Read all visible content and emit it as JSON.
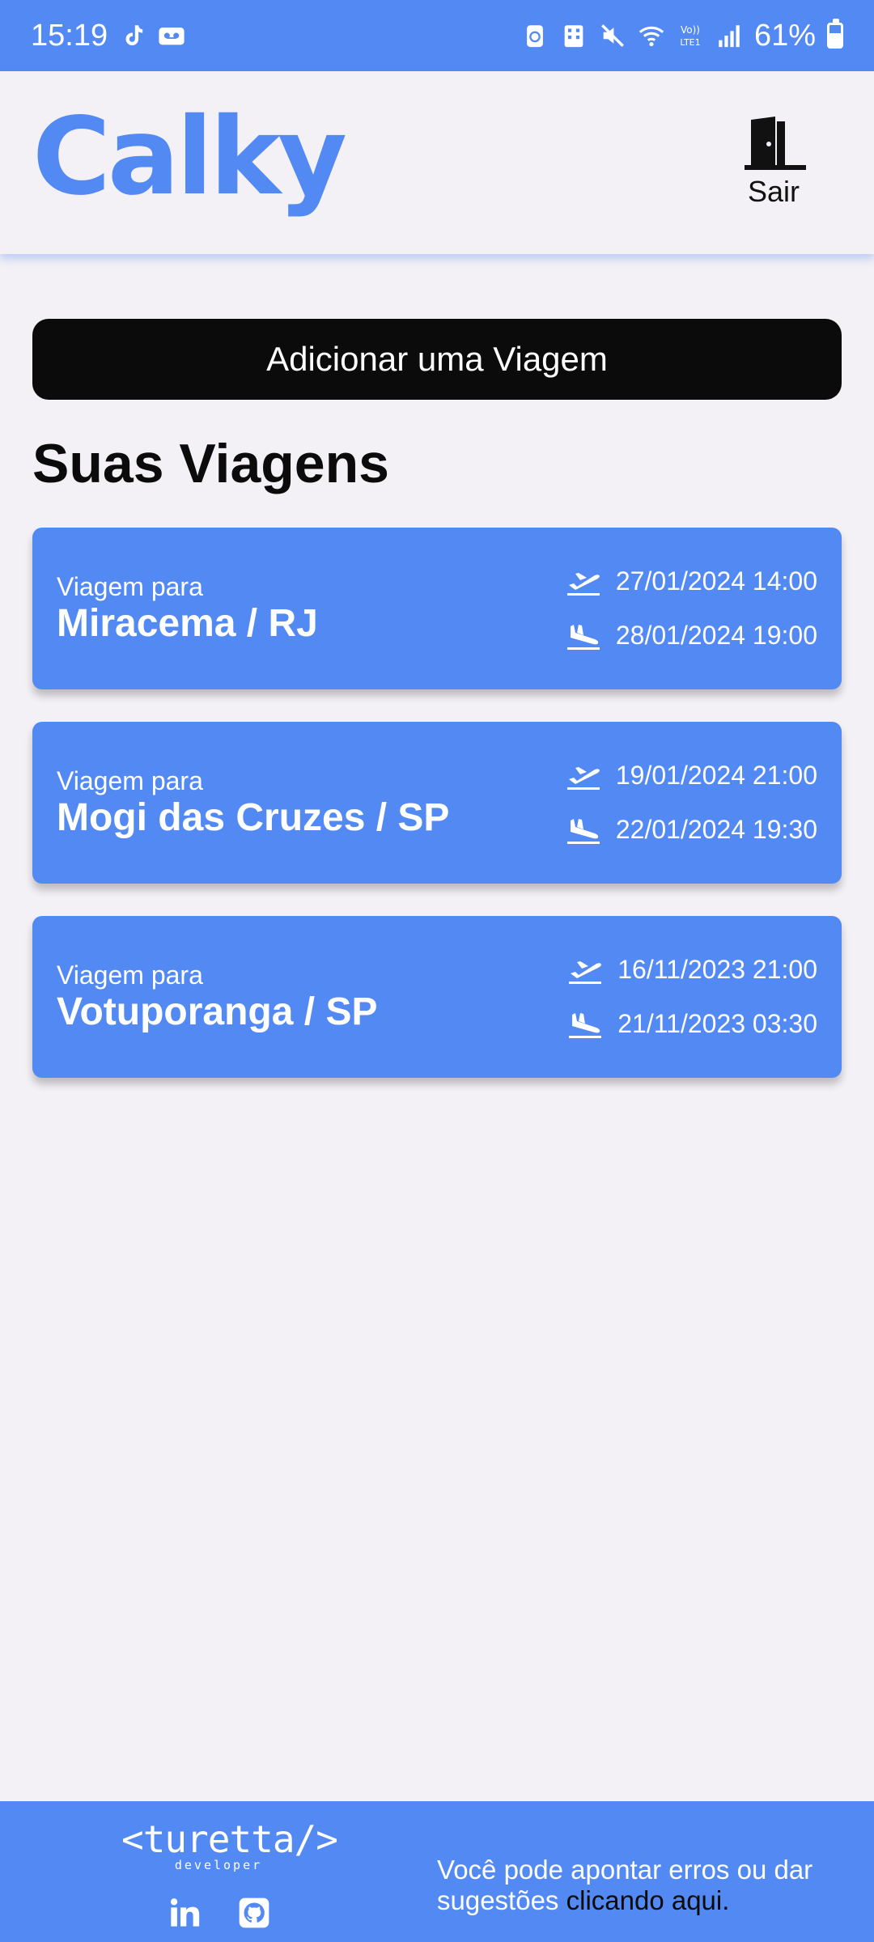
{
  "status_bar": {
    "time": "15:19",
    "battery": "61%",
    "battery_level": 0.61,
    "icons": [
      "tiktok-icon",
      "voicemail-icon",
      "eco-icon",
      "building-icon",
      "mute-icon",
      "wifi-icon",
      "volte-icon",
      "signal-icon"
    ]
  },
  "header": {
    "logo": "Calky",
    "logout_label": "Sair",
    "logout_icon": "door-icon"
  },
  "actions": {
    "add_trip": "Adicionar uma Viagem"
  },
  "trips_section": {
    "title": "Suas Viagens",
    "items": [
      {
        "label": "Viagem para",
        "destination": "Miracema / RJ",
        "departure": "27/01/2024 14:00",
        "arrival": "28/01/2024 19:00"
      },
      {
        "label": "Viagem para",
        "destination": "Mogi das Cruzes / SP",
        "departure": "19/01/2024 21:00",
        "arrival": "22/01/2024 19:30"
      },
      {
        "label": "Viagem para",
        "destination": "Votuporanga / SP",
        "departure": "16/11/2023 21:00",
        "arrival": "21/11/2023 03:30"
      }
    ]
  },
  "footer": {
    "brand": "<turetta/>",
    "brand_sub": "developer",
    "feedback_text": "Você pode apontar erros ou dar sugestões ",
    "feedback_link": "clicando aqui.",
    "social_icons": [
      "linkedin-icon",
      "github-icon"
    ]
  },
  "colors": {
    "accent": "#5289f3",
    "background": "#f3f1f5",
    "button": "#0b0b0b"
  }
}
